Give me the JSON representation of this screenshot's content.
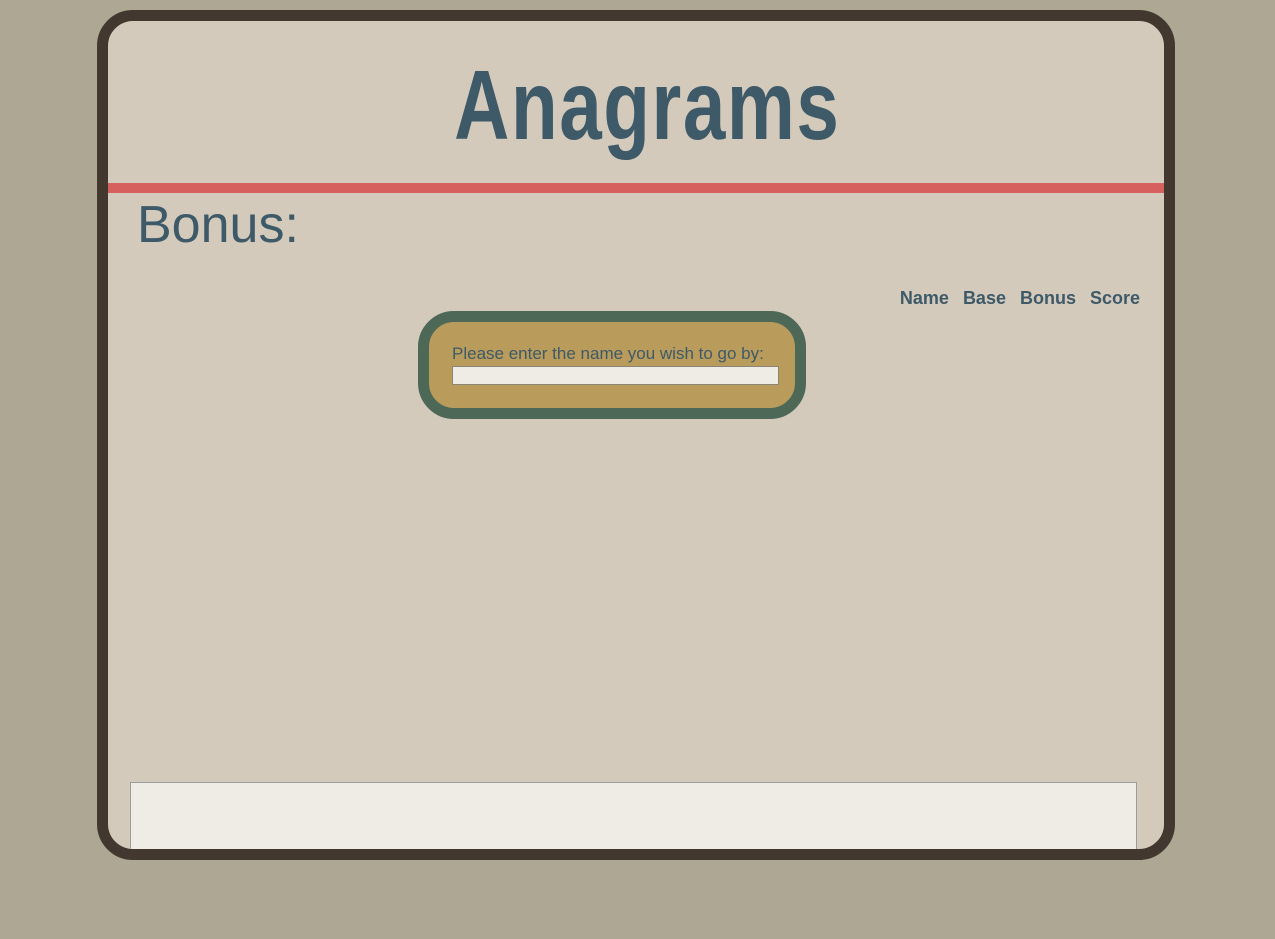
{
  "header": {
    "title": "Anagrams"
  },
  "bonus": {
    "label": "Bonus:"
  },
  "scoreboard": {
    "columns": [
      "Name",
      "Base",
      "Bonus",
      "Score"
    ]
  },
  "name_dialog": {
    "prompt": "Please enter the name you wish to go by:",
    "value": ""
  },
  "colors": {
    "page_background": "#ada793",
    "frame_border": "#42382f",
    "frame_background": "#d4cabb",
    "title_text": "#3e5a68",
    "divider": "#d6605d",
    "dialog_fill": "#b99b5b",
    "dialog_border": "#4d6857"
  }
}
